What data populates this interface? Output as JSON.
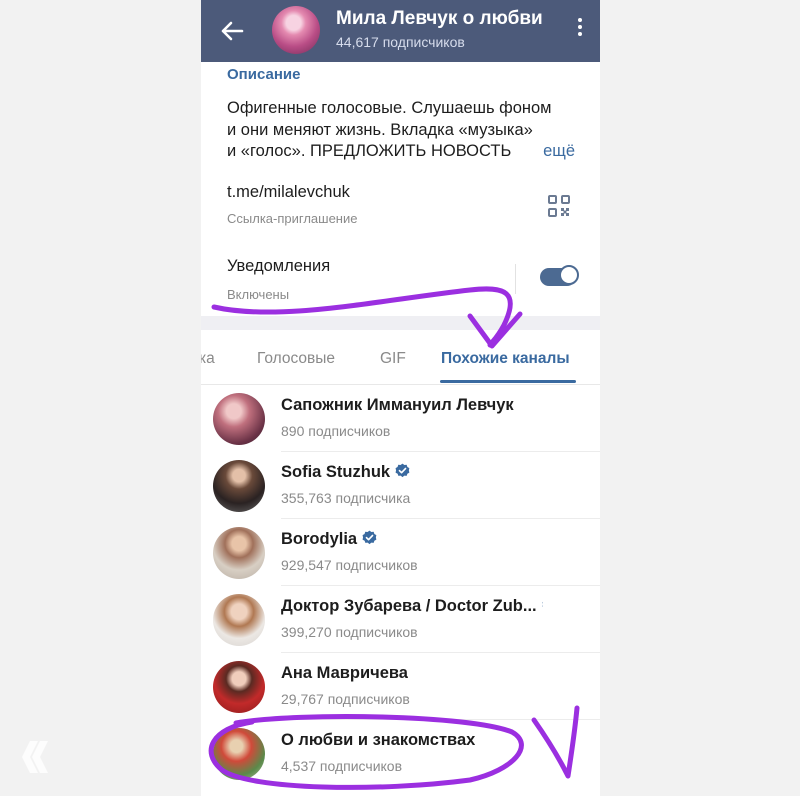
{
  "header": {
    "title": "Мила Левчук о любви",
    "subtitle": "44,617 подписчиков",
    "back_icon": "arrow-left-icon",
    "menu_icon": "more-vertical-icon"
  },
  "description": {
    "label": "Описание",
    "lines": [
      "Офигенные голосовые. Слушаешь фоном",
      "и они меняют жизнь. Вкладка «музыка»",
      "и «голос».  ПРЕДЛОЖИТЬ НОВОСТЬ"
    ],
    "more": "ещё"
  },
  "invite": {
    "link": "t.me/milalevchuk",
    "caption": "Ссылка-приглашение",
    "icon": "qr-code-icon"
  },
  "notifications": {
    "label": "Уведомления",
    "status": "Включены",
    "enabled": true
  },
  "tabs": [
    {
      "label": "ка"
    },
    {
      "label": "Голосовые"
    },
    {
      "label": "GIF"
    },
    {
      "label": "Похожие каналы",
      "active": true
    }
  ],
  "channels": [
    {
      "name": "Сапожник Иммануил Левчук",
      "subscribers": "890 подписчиков",
      "verified": false
    },
    {
      "name": "Sofia Stuzhuk",
      "subscribers": "355,763 подписчика",
      "verified": true
    },
    {
      "name": "Borodylia",
      "subscribers": "929,547 подписчиков",
      "verified": true
    },
    {
      "name": "Доктор Зубарева / Doctor Zub...",
      "subscribers": "399,270 подписчиков",
      "verified": true
    },
    {
      "name": "Ана Мавричева",
      "subscribers": "29,767 подписчиков",
      "verified": false
    },
    {
      "name": "О любви и знакомствах",
      "subscribers": "4,537 подписчиков",
      "verified": false
    }
  ],
  "colors": {
    "header_bg": "#4c5a7a",
    "accent": "#3a6aa0",
    "annotation": "#9b2fe0"
  }
}
